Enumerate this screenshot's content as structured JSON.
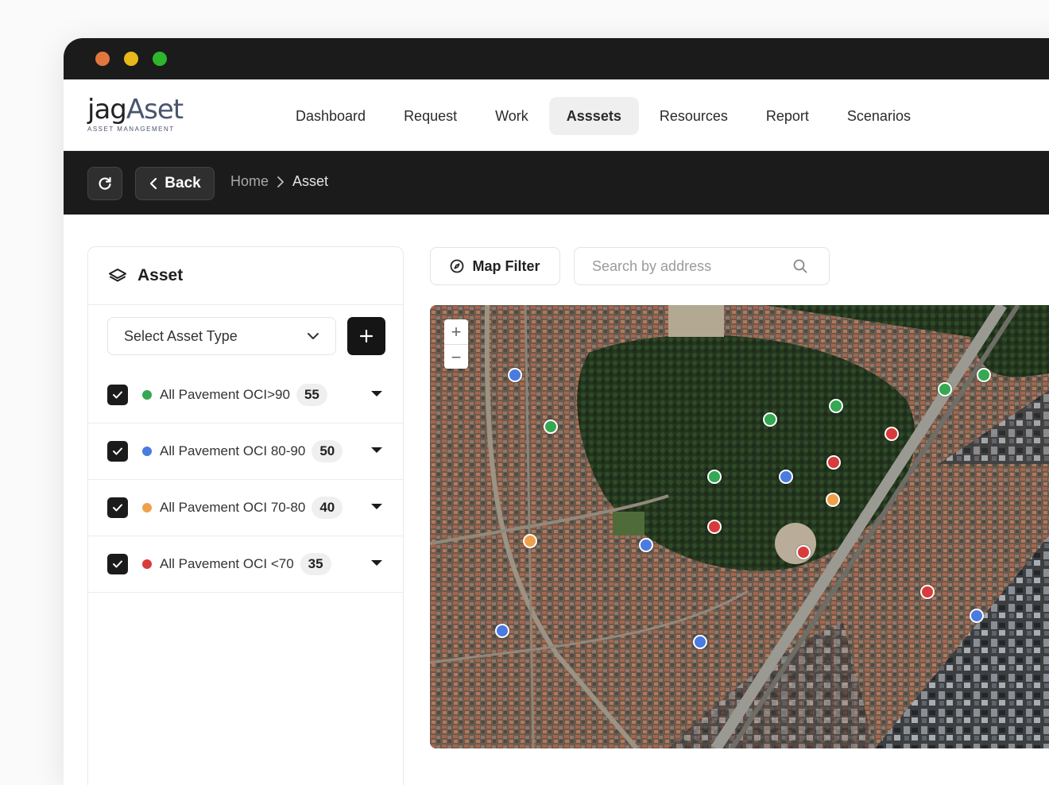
{
  "brand": {
    "name_part1": "jag",
    "name_part2": "Aset",
    "tagline": "ASSET MANAGEMENT"
  },
  "nav": {
    "items": [
      {
        "label": "Dashboard"
      },
      {
        "label": "Request"
      },
      {
        "label": "Work"
      },
      {
        "label": "Asssets",
        "active": true
      },
      {
        "label": "Resources"
      },
      {
        "label": "Report"
      },
      {
        "label": "Scenarios"
      }
    ]
  },
  "toolbar": {
    "back_label": "Back"
  },
  "breadcrumb": {
    "home": "Home",
    "current": "Asset"
  },
  "sidebar": {
    "title": "Asset",
    "select_placeholder": "Select Asset Type",
    "layers": [
      {
        "label": "All Pavement OCI>90",
        "count": "55",
        "color": "#34a853",
        "checked": true
      },
      {
        "label": "All Pavement OCI 80-90",
        "count": "50",
        "color": "#4a7be0",
        "checked": true
      },
      {
        "label": "All Pavement OCI 70-80",
        "count": "40",
        "color": "#f0a04b",
        "checked": true
      },
      {
        "label": "All Pavement OCI <70",
        "count": "35",
        "color": "#d93b3b",
        "checked": true
      }
    ]
  },
  "map": {
    "filter_label": "Map Filter",
    "search_placeholder": "Search by address",
    "zoom_in": "+",
    "zoom_out": "−"
  },
  "colors": {
    "dark": "#1b1b1b",
    "green": "#34a853",
    "blue": "#4a7be0",
    "orange": "#f0a04b",
    "red": "#d93b3b"
  }
}
